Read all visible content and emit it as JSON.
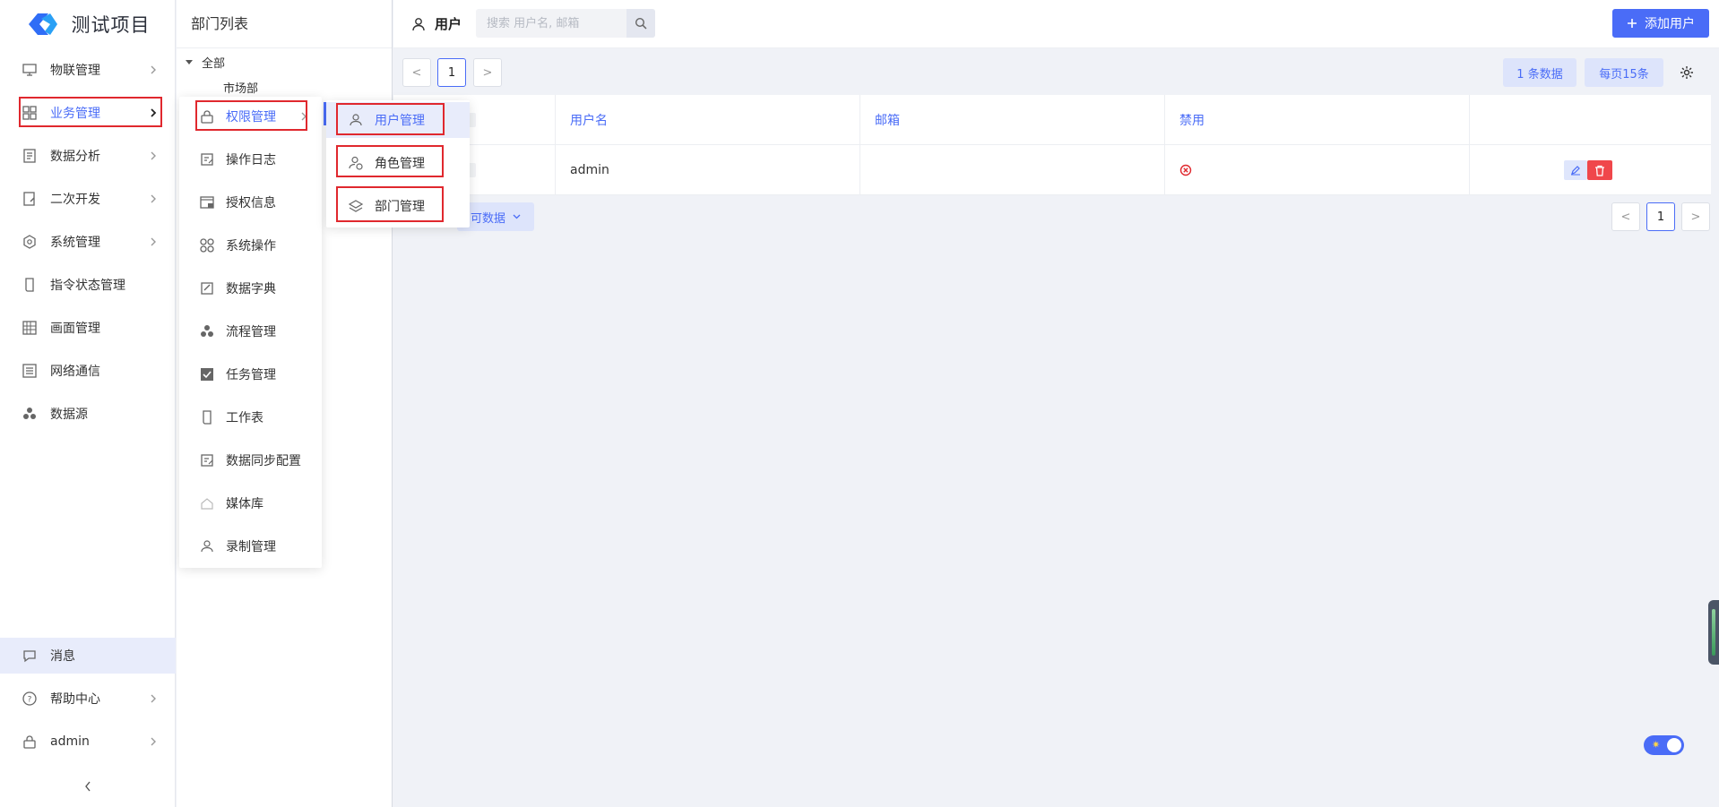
{
  "app": {
    "title": "测试项目",
    "brand_color": "#4a6cf7"
  },
  "sidebar": {
    "items": [
      {
        "label": "物联管理",
        "icon": "iot-monitor-icon",
        "has_children": true
      },
      {
        "label": "业务管理",
        "icon": "grid-apps-icon",
        "has_children": true,
        "active": true
      },
      {
        "label": "数据分析",
        "icon": "report-icon",
        "has_children": true
      },
      {
        "label": "二次开发",
        "icon": "code-edit-icon",
        "has_children": true
      },
      {
        "label": "系统管理",
        "icon": "hexagon-gear-icon",
        "has_children": true
      },
      {
        "label": "指令状态管理",
        "icon": "scroll-icon",
        "has_children": false
      },
      {
        "label": "画面管理",
        "icon": "screen-grid-icon",
        "has_children": false
      },
      {
        "label": "网络通信",
        "icon": "list-lines-icon",
        "has_children": false
      },
      {
        "label": "数据源",
        "icon": "cluster-dots-icon",
        "has_children": false
      }
    ],
    "bottom": [
      {
        "label": "消息",
        "icon": "chat-bubble-icon",
        "has_children": false
      },
      {
        "label": "帮助中心",
        "icon": "question-circle-icon",
        "has_children": true
      },
      {
        "label": "admin",
        "icon": "lock-icon",
        "has_children": true
      }
    ],
    "collapse_glyph": "<"
  },
  "dept_panel": {
    "title": "部门列表",
    "root": "全部",
    "children": [
      "市场部"
    ]
  },
  "header": {
    "section_label": "用户",
    "search_placeholder": "搜索 用户名, 邮箱",
    "add_button": "添加用户"
  },
  "toolbar": {
    "prev": "<",
    "page": "1",
    "next": ">",
    "count_label": "1 条数据",
    "per_page_label": "每页15条"
  },
  "table": {
    "columns": [
      "",
      "用户名",
      "邮箱",
      "禁用",
      ""
    ],
    "rows": [
      {
        "username": "admin",
        "email": "",
        "disabled_icon": "x-circle-icon"
      }
    ],
    "footer_pill": "可数据"
  },
  "flyout1": {
    "items": [
      {
        "label": "权限管理",
        "icon": "lock-icon",
        "has_children": true,
        "active": true
      },
      {
        "label": "操作日志",
        "icon": "log-edit-icon"
      },
      {
        "label": "授权信息",
        "icon": "window-auth-icon"
      },
      {
        "label": "系统操作",
        "icon": "four-circles-icon"
      },
      {
        "label": "数据字典",
        "icon": "dictionary-edit-icon"
      },
      {
        "label": "流程管理",
        "icon": "cluster-dots-icon"
      },
      {
        "label": "任务管理",
        "icon": "task-check-icon"
      },
      {
        "label": "工作表",
        "icon": "scroll-icon"
      },
      {
        "label": "数据同步配置",
        "icon": "sync-edit-icon"
      },
      {
        "label": "媒体库",
        "icon": "media-house-icon"
      },
      {
        "label": "录制管理",
        "icon": "users-group-icon"
      }
    ]
  },
  "flyout2": {
    "items": [
      {
        "label": "用户管理",
        "icon": "users-group-icon",
        "active": true
      },
      {
        "label": "角色管理",
        "icon": "role-user-icon"
      },
      {
        "label": "部门管理",
        "icon": "layers-icon"
      }
    ]
  }
}
